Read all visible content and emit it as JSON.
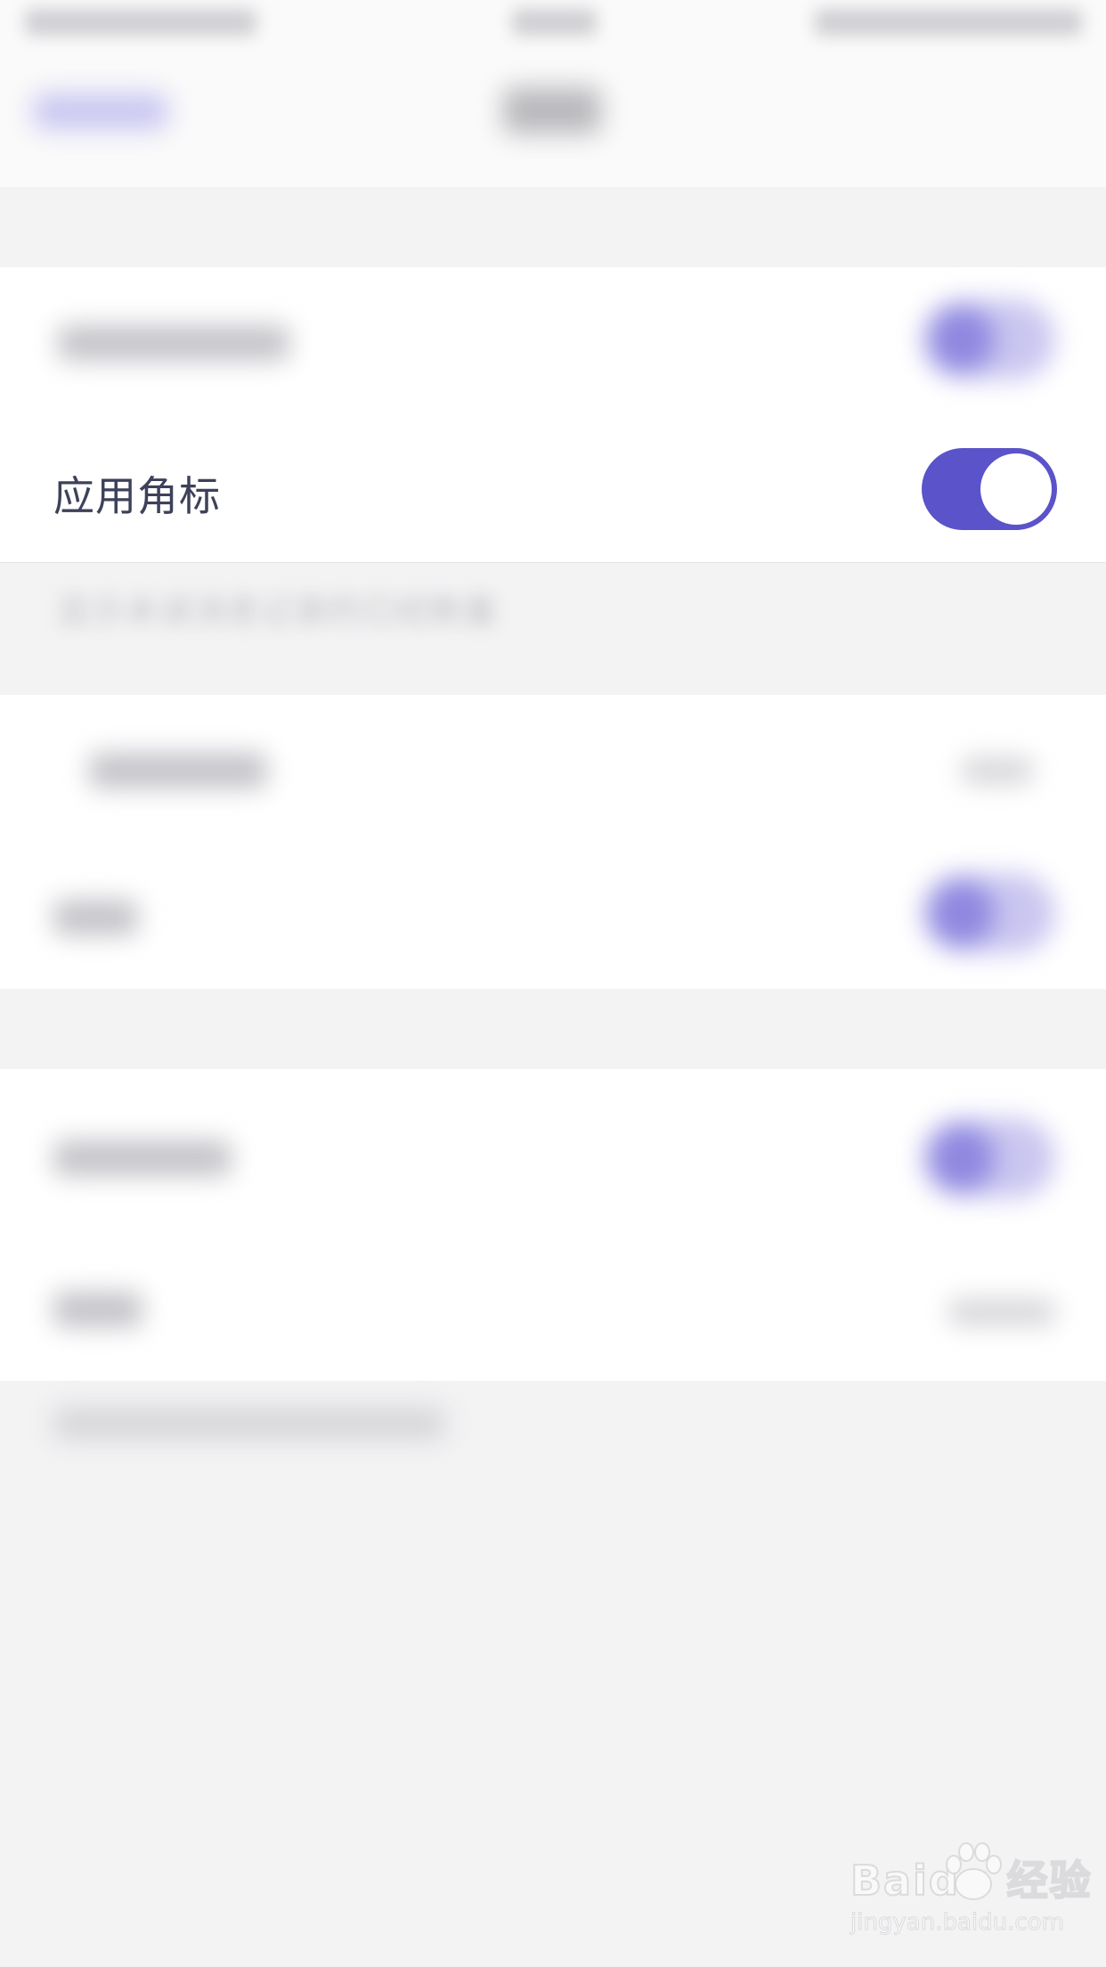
{
  "settings": {
    "app_badge": {
      "label": "应用角标",
      "enabled": true,
      "accent_color": "#5b53c9"
    },
    "app_badge_description": "显示未读消息记录的已经数量"
  },
  "watermark": {
    "logo": "Baidu 经验",
    "url": "jingyan.baidu.com"
  },
  "icons": {
    "watermark_icon": "baidu-paw-icon"
  }
}
